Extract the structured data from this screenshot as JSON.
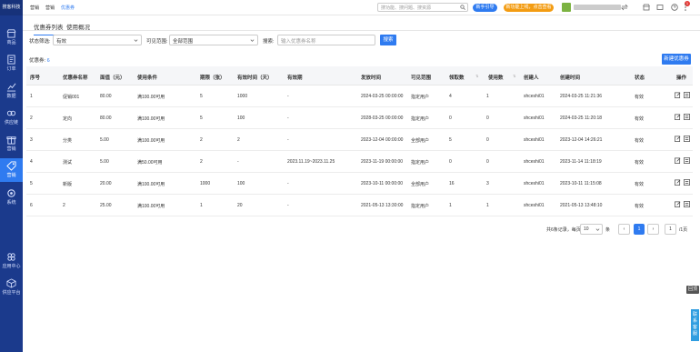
{
  "brand": {
    "logo_text": "搜客科技"
  },
  "sidebar": {
    "items": [
      {
        "label": "商品",
        "icon": "shop-icon"
      },
      {
        "label": "订单",
        "icon": "order-icon"
      },
      {
        "label": "数据",
        "icon": "chart-icon"
      },
      {
        "label": "供应链",
        "icon": "link-icon"
      },
      {
        "label": "营销",
        "icon": "gift-icon"
      },
      {
        "label": "营销",
        "icon": "tag-icon"
      },
      {
        "label": "系统",
        "icon": "gear-icon"
      },
      {
        "label": "应用中心",
        "icon": "apps-icon"
      },
      {
        "label": "供应平台",
        "icon": "cube-icon"
      }
    ]
  },
  "topbar": {
    "nav": [
      "营销",
      "营销",
      "优惠券"
    ],
    "search_placeholder": "搜功能、搜问题、搜资源",
    "btn_guide": "新手引导",
    "btn_promo": "新功能上线，点击查看",
    "icons": [
      "exchange-icon",
      "shop-icon",
      "message-icon",
      "help-icon",
      "more-icon"
    ],
    "badge": "1"
  },
  "tabs": [
    {
      "label": "优惠券列表",
      "active": true
    },
    {
      "label": "使用概况",
      "active": false
    }
  ],
  "filters": {
    "status_label": "状态筛选:",
    "status_value": "有效",
    "range_label": "可见范围:",
    "range_value": "全部范围",
    "search_label": "搜索:",
    "search_placeholder": "输入优惠券名称",
    "search_btn": "搜索"
  },
  "summary": {
    "label": "优惠券:",
    "count": "6"
  },
  "new_btn": "新建优惠券",
  "table": {
    "columns": [
      "序号",
      "优惠券名称",
      "面值（元）",
      "使用条件",
      "期限（张）",
      "有效时间（天）",
      "有效期",
      "发放时间",
      "可见范围",
      "领取数",
      "使用数",
      "创建人",
      "创建时间",
      "状态",
      "操作"
    ],
    "rows": [
      [
        "1",
        "促销001",
        "80.00",
        "满100.00可用",
        "5",
        "1000",
        "-",
        "2024-03-25 00:00:00",
        "指定用户",
        "4",
        "1",
        "shceshi01",
        "2024-03-25 11:21:36",
        "有效"
      ],
      [
        "2",
        "定向",
        "80.00",
        "满100.00可用",
        "5",
        "100",
        "-",
        "2028-03-25 00:00:00",
        "指定用户",
        "0",
        "0",
        "shceshi01",
        "2024-03-25 11:20:18",
        "有效"
      ],
      [
        "3",
        "分类",
        "5.00",
        "满100.00可用",
        "2",
        "2",
        "-",
        "2023-12-04 00:00:00",
        "全部用户",
        "5",
        "0",
        "shceshi01",
        "2023-12-04 14:26:21",
        "有效"
      ],
      [
        "4",
        "测试",
        "5.00",
        "满50.00可用",
        "2",
        "-",
        "2023.11.19~2023.11.25",
        "2023-11-19 00:00:00",
        "指定用户",
        "0",
        "0",
        "shceshi01",
        "2023-11-14 11:18:19",
        "有效"
      ],
      [
        "5",
        "新版",
        "20.00",
        "满100.00可用",
        "1000",
        "100",
        "-",
        "2023-10-11 00:00:00",
        "全部用户",
        "16",
        "3",
        "shceshi01",
        "2023-10-11 11:15:08",
        "有效"
      ],
      [
        "6",
        "2",
        "25.00",
        "满100.00可用",
        "1",
        "20",
        "-",
        "2021-05-13 13:30:00",
        "指定用户",
        "1",
        "1",
        "shceshi01",
        "2021-05-13 13:48:10",
        "有效"
      ]
    ]
  },
  "pagination": {
    "summary": "共6条记录，每页",
    "page_size": "10",
    "unit": "条",
    "prev": "‹",
    "current": "1",
    "next": "›",
    "jump_value": "1",
    "total_pages": "/1页"
  },
  "float": {
    "top": "回顶",
    "side": "联系客服"
  },
  "colors": {
    "sidebar": "#1b3a8c",
    "accent": "#2f7bf0",
    "promo": "#f39c12"
  }
}
